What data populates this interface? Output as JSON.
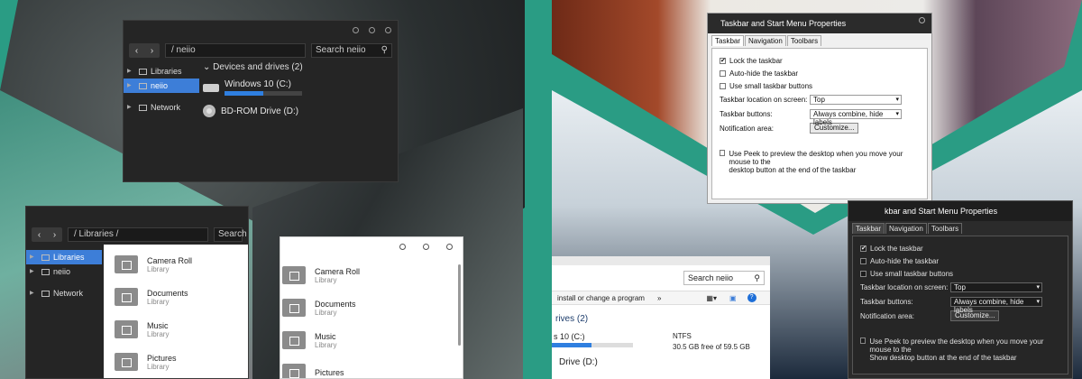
{
  "explorer_dark": {
    "address": "/  neiio",
    "search_placeholder": "Search neiio",
    "sidebar": [
      {
        "label": "Libraries"
      },
      {
        "label": "neiio"
      },
      {
        "label": "Network"
      }
    ],
    "section_header": "Devices and drives (2)",
    "drives": [
      {
        "name": "Windows 10 (C:)",
        "used_fraction": 0.5
      },
      {
        "name": "BD-ROM Drive (D:)"
      }
    ]
  },
  "explorer_libraries": {
    "address": "/  Libraries  /",
    "search_placeholder": "Search",
    "sidebar": [
      {
        "label": "Libraries"
      },
      {
        "label": "neiio"
      },
      {
        "label": "Network"
      }
    ],
    "items": [
      {
        "name": "Camera Roll",
        "sub": "Library"
      },
      {
        "name": "Documents",
        "sub": "Library"
      },
      {
        "name": "Music",
        "sub": "Library"
      },
      {
        "name": "Pictures",
        "sub": "Library"
      }
    ]
  },
  "explorer_light": {
    "items": [
      {
        "name": "Camera Roll",
        "sub": "Library"
      },
      {
        "name": "Documents",
        "sub": "Library"
      },
      {
        "name": "Music",
        "sub": "Library"
      },
      {
        "name": "Pictures",
        "sub": ""
      }
    ]
  },
  "explorer_light2": {
    "search_placeholder": "Search neiio",
    "toolbar_label": "install or change a program",
    "toolbar_chevron": "»",
    "section_header": "rives (2)",
    "drive_name": "s 10 (C:)",
    "fs": "NTFS",
    "space": "30.5 GB free of 59.5 GB",
    "used_fraction": 0.49,
    "drive2": "Drive (D:)"
  },
  "props_light": {
    "title": "Taskbar and Start Menu Properties",
    "tabs": [
      "Taskbar",
      "Navigation",
      "Toolbars"
    ],
    "checks": [
      {
        "label": "Lock the taskbar",
        "checked": "✔"
      },
      {
        "label": "Auto-hide the taskbar",
        "checked": ""
      },
      {
        "label": "Use small taskbar buttons",
        "checked": ""
      }
    ],
    "location_label": "Taskbar location on screen:",
    "location_value": "Top",
    "buttons_label": "Taskbar buttons:",
    "buttons_value": "Always combine, hide labels",
    "notif_label": "Notification area:",
    "customize": "Customize...",
    "peek_text": "Use Peek to preview the desktop when you move your mouse to the\ndesktop button at the end of the taskbar"
  },
  "props_dark": {
    "title": "kbar and Start Menu Properties",
    "tabs": [
      "Taskbar",
      "Navigation",
      "Toolbars"
    ],
    "checks": [
      {
        "label": "Lock the taskbar",
        "checked": "✔"
      },
      {
        "label": "Auto-hide the taskbar",
        "checked": ""
      },
      {
        "label": "Use small taskbar buttons",
        "checked": ""
      }
    ],
    "location_label": "Taskbar location on screen:",
    "location_value": "Top",
    "buttons_label": "Taskbar buttons:",
    "buttons_value": "Always combine, hide labels",
    "notif_label": "Notification area:",
    "customize": "Customize...",
    "peek_text": "Use Peek to preview the desktop when you move your mouse to the\nShow desktop button at the end of the taskbar"
  },
  "colors": {
    "teal": "#2a9c84",
    "accent": "#3d7ed8"
  }
}
